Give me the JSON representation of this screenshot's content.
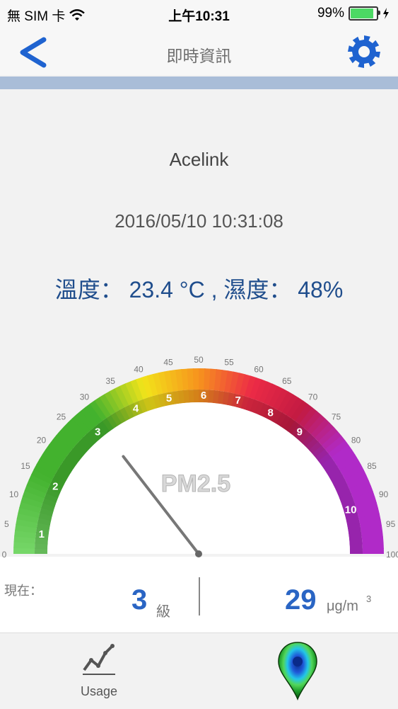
{
  "status_bar": {
    "carrier": "無 SIM 卡",
    "time": "上午10:31",
    "battery": "99%",
    "battery_level": 0.99
  },
  "nav": {
    "title": "即時資訊",
    "back_icon": "chevron-left-icon",
    "settings_icon": "gear-icon"
  },
  "info": {
    "device": "Acelink",
    "timestamp": "2016/05/10 10:31:08",
    "environment": "溫度： 23.4 °C , 濕度： 48%"
  },
  "gauge": {
    "label": "PM2.5",
    "min": 0,
    "max": 100,
    "tick_labels": [
      "0",
      "5",
      "10",
      "15",
      "20",
      "25",
      "30",
      "35",
      "40",
      "45",
      "50",
      "55",
      "60",
      "65",
      "70",
      "75",
      "80",
      "85",
      "90",
      "95",
      "100"
    ],
    "level_labels": [
      "1",
      "2",
      "3",
      "4",
      "5",
      "6",
      "7",
      "8",
      "9",
      "10"
    ],
    "needle_value": 29,
    "colors": {
      "green_light": "#78d86a",
      "green": "#43b22e",
      "yellow": "#f2e41a",
      "orange": "#f7941d",
      "red": "#ec2b46",
      "crimson": "#c21a42",
      "purple": "#b02ac8",
      "needle": "#777777"
    }
  },
  "readings": {
    "now_label": "現在：",
    "level": "3",
    "level_unit": "級",
    "pm": "29",
    "pm_unit": "μg/m",
    "pm_unit_sup": "3"
  },
  "tabs": {
    "usage_label": "Usage",
    "usage_icon": "line-chart-icon",
    "map_icon": "map-pin-icon"
  }
}
